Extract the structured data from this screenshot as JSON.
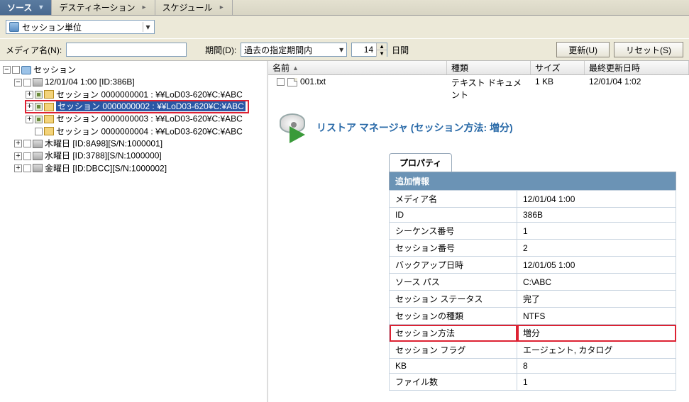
{
  "tabs": {
    "source": "ソース",
    "destination": "デスティネーション",
    "schedule": "スケジュール"
  },
  "viewSelect": "セッション単位",
  "filter": {
    "mediaLabel": "メディア名(N):",
    "mediaValue": "",
    "periodLabel": "期間(D):",
    "periodValue": "過去の指定期間内",
    "countValue": "14",
    "unit": "日間",
    "updateBtn": "更新(U)",
    "resetBtn": "リセット(S)"
  },
  "tree": {
    "root": "セッション",
    "media": "12/01/04 1:00  [ID:386B]",
    "sessions": [
      "セッション 0000000001 : ¥¥LoD03-620¥C:¥ABC",
      "セッション 0000000002 : ¥¥LoD03-620¥C:¥ABC",
      "セッション 0000000003 : ¥¥LoD03-620¥C:¥ABC",
      "セッション 0000000004 : ¥¥LoD03-620¥C:¥ABC"
    ],
    "days": [
      "木曜日 [ID:8A98][S/N:1000001]",
      "水曜日 [ID:3788][S/N:1000000]",
      "金曜日 [ID:DBCC][S/N:1000002]"
    ]
  },
  "list": {
    "cols": {
      "name": "名前",
      "type": "種類",
      "size": "サイズ",
      "date": "最終更新日時"
    },
    "rows": [
      {
        "name": "001.txt",
        "type": "テキスト ドキュメント",
        "size": "1 KB",
        "date": "12/01/04  1:02"
      }
    ]
  },
  "restoreTitle": "リストア マネージャ  (セッション方法: 増分)",
  "props": {
    "tab": "プロパティ",
    "section": "追加情報",
    "rows": [
      {
        "k": "メディア名",
        "v": "12/01/04 1:00"
      },
      {
        "k": "ID",
        "v": "386B"
      },
      {
        "k": "シーケンス番号",
        "v": "1"
      },
      {
        "k": "セッション番号",
        "v": "2"
      },
      {
        "k": "バックアップ日時",
        "v": "12/01/05 1:00"
      },
      {
        "k": "ソース パス",
        "v": "C:\\ABC"
      },
      {
        "k": "セッション ステータス",
        "v": "完了"
      },
      {
        "k": "セッションの種類",
        "v": "NTFS"
      },
      {
        "k": "セッション方法",
        "v": "増分"
      },
      {
        "k": "セッション フラグ",
        "v": "エージェント, カタログ"
      },
      {
        "k": "KB",
        "v": "8"
      },
      {
        "k": "ファイル数",
        "v": "1"
      }
    ]
  }
}
